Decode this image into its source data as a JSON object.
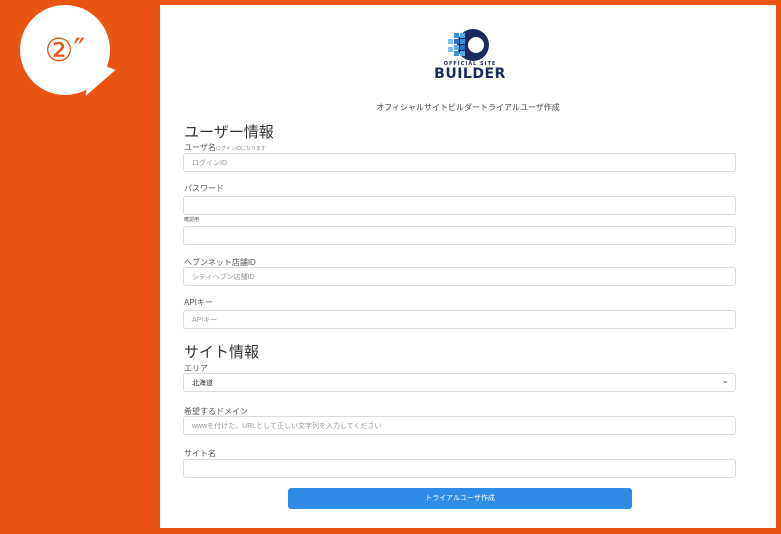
{
  "badge": {
    "text": "②″"
  },
  "header": {
    "logo_small": "OFFICIAL SITE",
    "logo_big": "BUILDER",
    "subtitle": "オフィシャルサイトビルダートライアルユーザ作成"
  },
  "user_section": {
    "title": "ユーザー情報",
    "username_label": "ユーザ名",
    "username_hint": "ログインIDになります",
    "username_placeholder": "ログインID",
    "password_label": "パスワード",
    "confirm_label": "確認用",
    "heaven_id_label": "ヘブンネット店舗ID",
    "heaven_id_placeholder": "シティヘブン店舗ID",
    "api_key_label": "APIキー",
    "api_key_placeholder": "APIキー"
  },
  "site_section": {
    "title": "サイト情報",
    "area_label": "エリア",
    "area_value": "北海道",
    "domain_label": "希望するドメイン",
    "domain_placeholder": "wwwを付けた、URLとして正しい文字列を入力してください",
    "site_name_label": "サイト名"
  },
  "submit_label": "トライアルユーザ作成",
  "colors": {
    "background": "#ea5413",
    "button": "#2e8be6",
    "logo": "#1a2a5e"
  }
}
